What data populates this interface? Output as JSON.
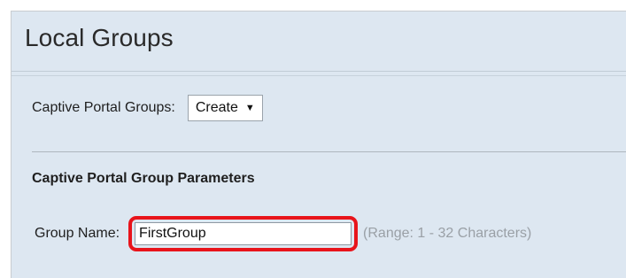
{
  "page": {
    "title": "Local Groups"
  },
  "captive_portal": {
    "groups_label": "Captive Portal Groups:",
    "groups_select_value": "Create",
    "arrow": "▼"
  },
  "parameters": {
    "section_title": "Captive Portal Group Parameters",
    "group_name_label": "Group Name:",
    "group_name_value": "FirstGroup",
    "group_name_hint": "(Range: 1 - 32 Characters)"
  },
  "colors": {
    "panel_background": "#dde7f1",
    "highlight_border": "#e8141b",
    "hint_text": "#9aa0a6"
  }
}
